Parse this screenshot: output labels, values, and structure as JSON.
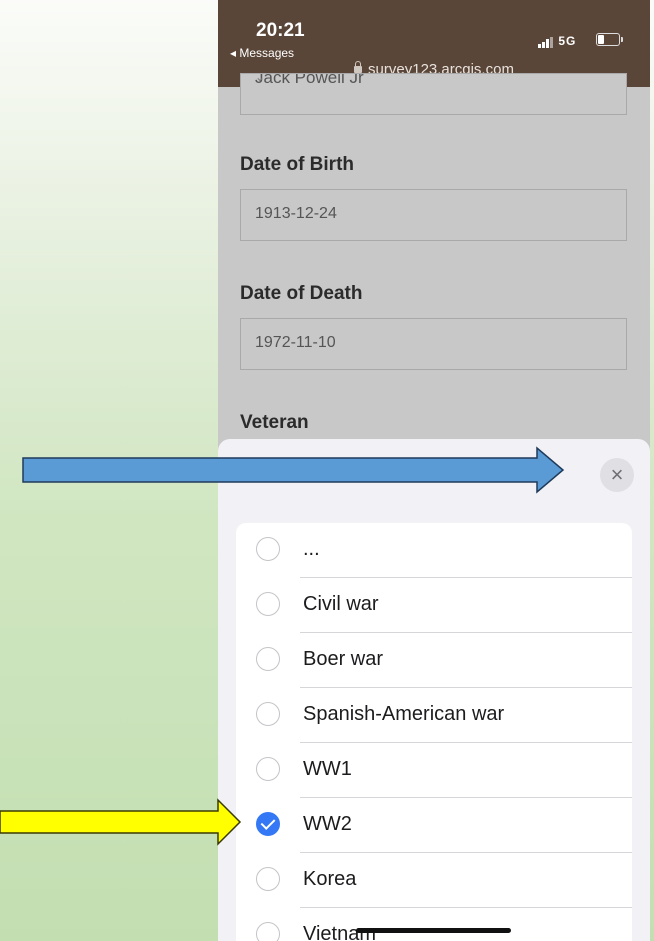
{
  "status_bar": {
    "time": "20:21",
    "back_label": "◂ Messages",
    "network": "5G",
    "url": "survey123.arcgis.com"
  },
  "form": {
    "partial_value": "Jack Powell Jr",
    "fields": [
      {
        "label": "Date of Birth",
        "value": "1913-12-24"
      },
      {
        "label": "Date of Death",
        "value": "1972-11-10"
      }
    ],
    "veteran_label": "Veteran"
  },
  "picker": {
    "close_icon": "×",
    "options": [
      {
        "label": "...",
        "checked": false
      },
      {
        "label": "Civil war",
        "checked": false
      },
      {
        "label": "Boer war",
        "checked": false
      },
      {
        "label": "Spanish-American war",
        "checked": false
      },
      {
        "label": "WW1",
        "checked": false
      },
      {
        "label": "WW2",
        "checked": true
      },
      {
        "label": "Korea",
        "checked": false
      },
      {
        "label": "Vietnam",
        "checked": false
      }
    ]
  },
  "annotations": {
    "blue_arrow_color": "#5b9bd5",
    "yellow_arrow_color": "#ffff00",
    "check_color": "#3478f6"
  }
}
